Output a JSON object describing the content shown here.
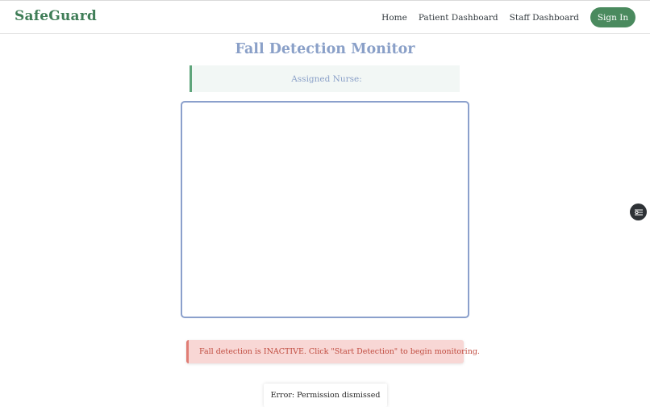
{
  "header": {
    "brand": "SafeGuard",
    "nav": {
      "home": "Home",
      "patient_dashboard": "Patient Dashboard",
      "staff_dashboard": "Staff Dashboard",
      "sign_in": "Sign In"
    }
  },
  "main": {
    "title": "Fall Detection Monitor",
    "assigned_nurse_label": "Assigned Nurse:",
    "status_message": "Fall detection is INACTIVE. Click \"Start Detection\" to begin monitoring.",
    "error_message": "Error: Permission dismissed"
  },
  "icons": {
    "floating_widget": "settings-sliders-icon"
  },
  "colors": {
    "brand": "#3f7d57",
    "primary_button": "#4a8a5e",
    "title": "#8aa0c8",
    "alert_bg": "#f8d7d5",
    "alert_text": "#c04b3f",
    "nurse_banner_border": "#5fa57b",
    "video_frame_border": "#8ba0cc"
  }
}
